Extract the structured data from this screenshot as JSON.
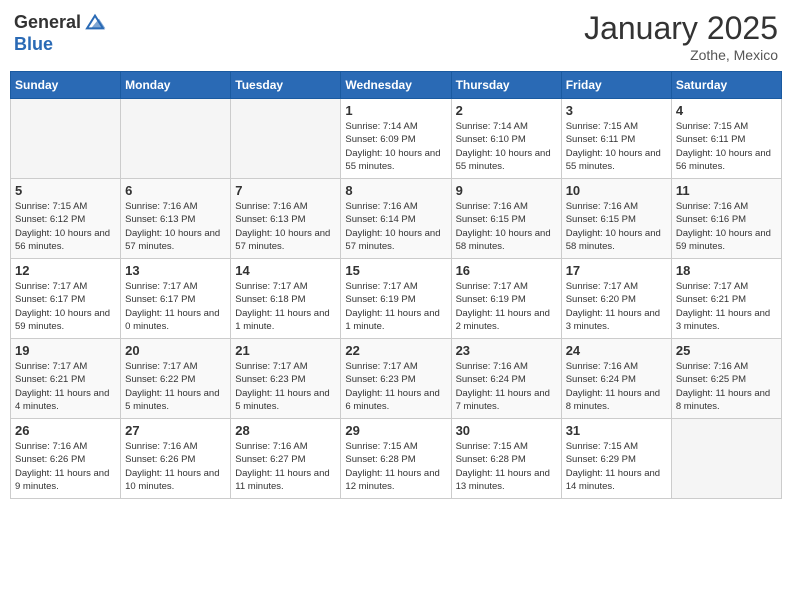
{
  "header": {
    "logo_general": "General",
    "logo_blue": "Blue",
    "month": "January 2025",
    "location": "Zothe, Mexico"
  },
  "weekdays": [
    "Sunday",
    "Monday",
    "Tuesday",
    "Wednesday",
    "Thursday",
    "Friday",
    "Saturday"
  ],
  "weeks": [
    [
      {
        "day": "",
        "empty": true
      },
      {
        "day": "",
        "empty": true
      },
      {
        "day": "",
        "empty": true
      },
      {
        "day": "1",
        "sunrise": "Sunrise: 7:14 AM",
        "sunset": "Sunset: 6:09 PM",
        "daylight": "Daylight: 10 hours and 55 minutes."
      },
      {
        "day": "2",
        "sunrise": "Sunrise: 7:14 AM",
        "sunset": "Sunset: 6:10 PM",
        "daylight": "Daylight: 10 hours and 55 minutes."
      },
      {
        "day": "3",
        "sunrise": "Sunrise: 7:15 AM",
        "sunset": "Sunset: 6:11 PM",
        "daylight": "Daylight: 10 hours and 55 minutes."
      },
      {
        "day": "4",
        "sunrise": "Sunrise: 7:15 AM",
        "sunset": "Sunset: 6:11 PM",
        "daylight": "Daylight: 10 hours and 56 minutes."
      }
    ],
    [
      {
        "day": "5",
        "sunrise": "Sunrise: 7:15 AM",
        "sunset": "Sunset: 6:12 PM",
        "daylight": "Daylight: 10 hours and 56 minutes."
      },
      {
        "day": "6",
        "sunrise": "Sunrise: 7:16 AM",
        "sunset": "Sunset: 6:13 PM",
        "daylight": "Daylight: 10 hours and 57 minutes."
      },
      {
        "day": "7",
        "sunrise": "Sunrise: 7:16 AM",
        "sunset": "Sunset: 6:13 PM",
        "daylight": "Daylight: 10 hours and 57 minutes."
      },
      {
        "day": "8",
        "sunrise": "Sunrise: 7:16 AM",
        "sunset": "Sunset: 6:14 PM",
        "daylight": "Daylight: 10 hours and 57 minutes."
      },
      {
        "day": "9",
        "sunrise": "Sunrise: 7:16 AM",
        "sunset": "Sunset: 6:15 PM",
        "daylight": "Daylight: 10 hours and 58 minutes."
      },
      {
        "day": "10",
        "sunrise": "Sunrise: 7:16 AM",
        "sunset": "Sunset: 6:15 PM",
        "daylight": "Daylight: 10 hours and 58 minutes."
      },
      {
        "day": "11",
        "sunrise": "Sunrise: 7:16 AM",
        "sunset": "Sunset: 6:16 PM",
        "daylight": "Daylight: 10 hours and 59 minutes."
      }
    ],
    [
      {
        "day": "12",
        "sunrise": "Sunrise: 7:17 AM",
        "sunset": "Sunset: 6:17 PM",
        "daylight": "Daylight: 10 hours and 59 minutes."
      },
      {
        "day": "13",
        "sunrise": "Sunrise: 7:17 AM",
        "sunset": "Sunset: 6:17 PM",
        "daylight": "Daylight: 11 hours and 0 minutes."
      },
      {
        "day": "14",
        "sunrise": "Sunrise: 7:17 AM",
        "sunset": "Sunset: 6:18 PM",
        "daylight": "Daylight: 11 hours and 1 minute."
      },
      {
        "day": "15",
        "sunrise": "Sunrise: 7:17 AM",
        "sunset": "Sunset: 6:19 PM",
        "daylight": "Daylight: 11 hours and 1 minute."
      },
      {
        "day": "16",
        "sunrise": "Sunrise: 7:17 AM",
        "sunset": "Sunset: 6:19 PM",
        "daylight": "Daylight: 11 hours and 2 minutes."
      },
      {
        "day": "17",
        "sunrise": "Sunrise: 7:17 AM",
        "sunset": "Sunset: 6:20 PM",
        "daylight": "Daylight: 11 hours and 3 minutes."
      },
      {
        "day": "18",
        "sunrise": "Sunrise: 7:17 AM",
        "sunset": "Sunset: 6:21 PM",
        "daylight": "Daylight: 11 hours and 3 minutes."
      }
    ],
    [
      {
        "day": "19",
        "sunrise": "Sunrise: 7:17 AM",
        "sunset": "Sunset: 6:21 PM",
        "daylight": "Daylight: 11 hours and 4 minutes."
      },
      {
        "day": "20",
        "sunrise": "Sunrise: 7:17 AM",
        "sunset": "Sunset: 6:22 PM",
        "daylight": "Daylight: 11 hours and 5 minutes."
      },
      {
        "day": "21",
        "sunrise": "Sunrise: 7:17 AM",
        "sunset": "Sunset: 6:23 PM",
        "daylight": "Daylight: 11 hours and 5 minutes."
      },
      {
        "day": "22",
        "sunrise": "Sunrise: 7:17 AM",
        "sunset": "Sunset: 6:23 PM",
        "daylight": "Daylight: 11 hours and 6 minutes."
      },
      {
        "day": "23",
        "sunrise": "Sunrise: 7:16 AM",
        "sunset": "Sunset: 6:24 PM",
        "daylight": "Daylight: 11 hours and 7 minutes."
      },
      {
        "day": "24",
        "sunrise": "Sunrise: 7:16 AM",
        "sunset": "Sunset: 6:24 PM",
        "daylight": "Daylight: 11 hours and 8 minutes."
      },
      {
        "day": "25",
        "sunrise": "Sunrise: 7:16 AM",
        "sunset": "Sunset: 6:25 PM",
        "daylight": "Daylight: 11 hours and 8 minutes."
      }
    ],
    [
      {
        "day": "26",
        "sunrise": "Sunrise: 7:16 AM",
        "sunset": "Sunset: 6:26 PM",
        "daylight": "Daylight: 11 hours and 9 minutes."
      },
      {
        "day": "27",
        "sunrise": "Sunrise: 7:16 AM",
        "sunset": "Sunset: 6:26 PM",
        "daylight": "Daylight: 11 hours and 10 minutes."
      },
      {
        "day": "28",
        "sunrise": "Sunrise: 7:16 AM",
        "sunset": "Sunset: 6:27 PM",
        "daylight": "Daylight: 11 hours and 11 minutes."
      },
      {
        "day": "29",
        "sunrise": "Sunrise: 7:15 AM",
        "sunset": "Sunset: 6:28 PM",
        "daylight": "Daylight: 11 hours and 12 minutes."
      },
      {
        "day": "30",
        "sunrise": "Sunrise: 7:15 AM",
        "sunset": "Sunset: 6:28 PM",
        "daylight": "Daylight: 11 hours and 13 minutes."
      },
      {
        "day": "31",
        "sunrise": "Sunrise: 7:15 AM",
        "sunset": "Sunset: 6:29 PM",
        "daylight": "Daylight: 11 hours and 14 minutes."
      },
      {
        "day": "",
        "empty": true
      }
    ]
  ]
}
